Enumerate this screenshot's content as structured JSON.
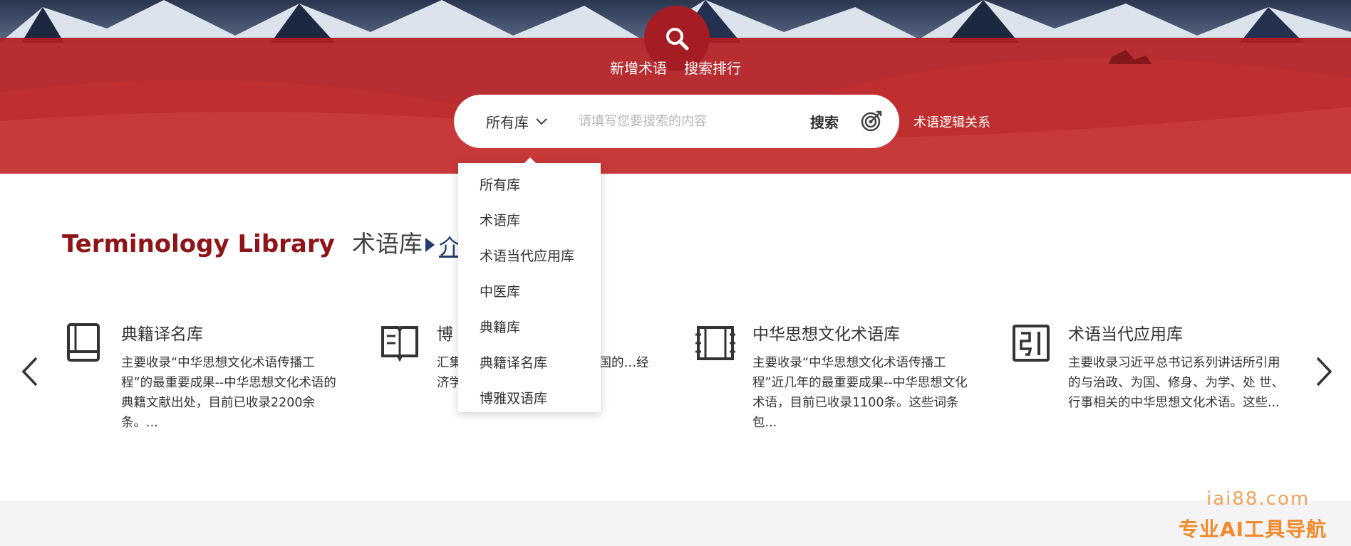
{
  "header": {
    "nav_links": [
      "新增术语",
      "搜索排行"
    ],
    "logic_link": "术语逻辑关系"
  },
  "search": {
    "library_selected": "所有库",
    "placeholder": "请填写您要搜索的内容",
    "button_label": "搜索"
  },
  "dropdown": {
    "options": [
      "所有库",
      "术语库",
      "术语当代应用库",
      "中医库",
      "典籍库",
      "典籍译名库",
      "博雅双语库"
    ]
  },
  "section": {
    "title_en": "Terminology Library",
    "title_cn": "术语库",
    "intro_link": "介"
  },
  "cards": [
    {
      "icon": "book-icon",
      "title": "典籍译名库",
      "desc": "主要收录“中华思想文化术语传播工程”的最重要成果--中华思想文化术语的典籍文献出处，目前已收录2200余条。..."
    },
    {
      "icon": "open-book-icon",
      "title": "博",
      "desc": "汇集…、汤一介、…等研究中国的…经济学、历..."
    },
    {
      "icon": "scroll-icon",
      "title": "中华思想文化术语库",
      "desc": "主要收录“中华思想文化术语传播工程”近几年的最重要成果--中华思想文化术语，目前已收录1100条。这些词条包..."
    },
    {
      "icon": "yin-character-icon",
      "title": "术语当代应用库",
      "desc": "主要收录习近平总书记系列讲话所引用的与治政、为国、修身、为学、处 世、行事相关的中华思想文化术语。这些..."
    }
  ],
  "watermark": {
    "domain": "iai88.com",
    "tagline": "专业AI工具导航"
  },
  "colors": {
    "brand_red": "#a51d22",
    "title_red": "#8f1418",
    "link_blue": "#1f3a6b",
    "watermark_orange": "#f08a2b"
  }
}
